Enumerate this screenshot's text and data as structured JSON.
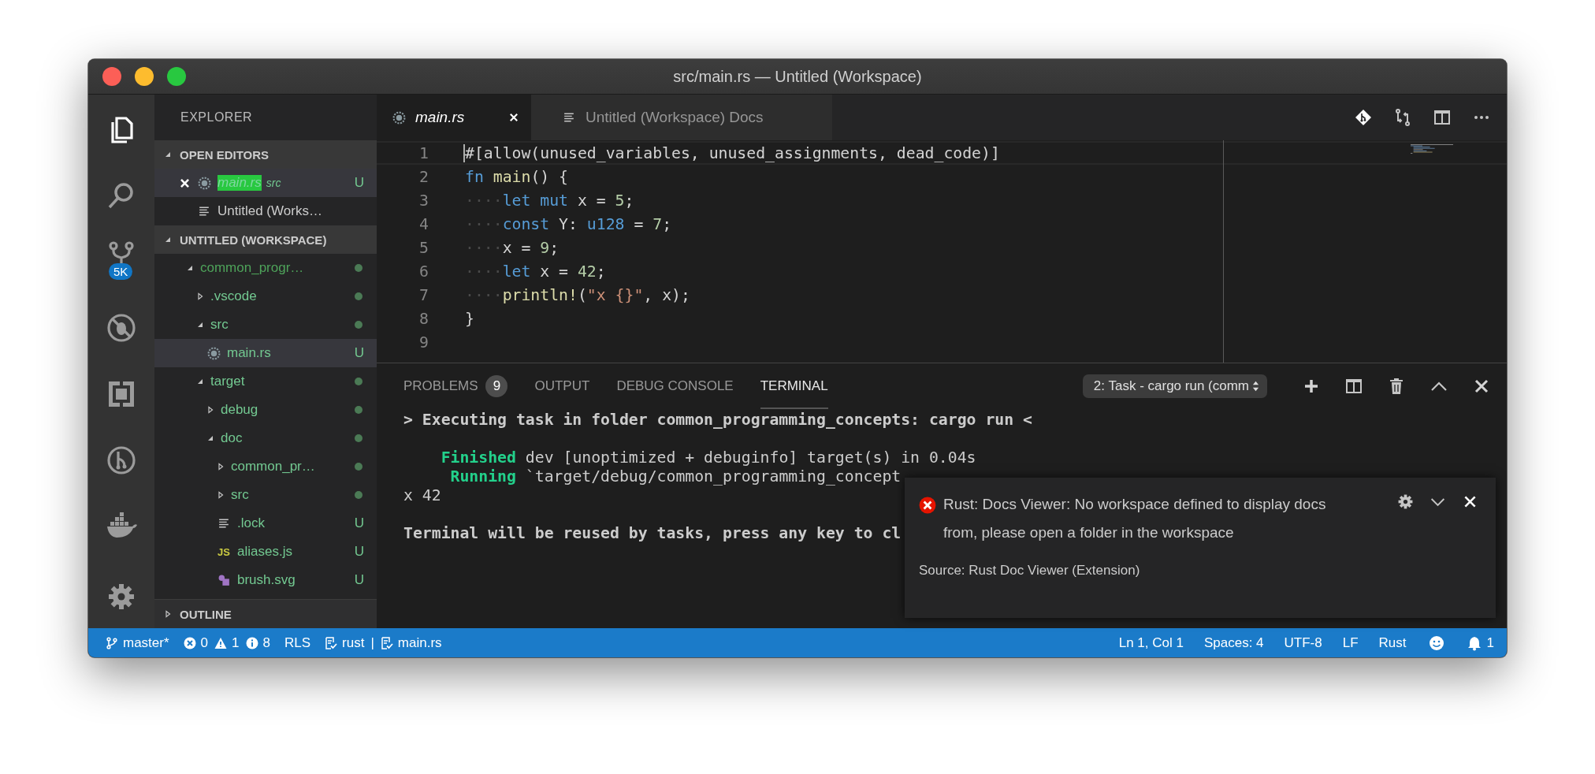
{
  "window": {
    "title": "src/main.rs — Untitled (Workspace)"
  },
  "activity_bar": [
    {
      "kind": "files",
      "selected": true
    },
    {
      "kind": "search",
      "selected": false
    },
    {
      "kind": "source-control",
      "selected": false,
      "badge": "5K"
    },
    {
      "kind": "no-debug",
      "selected": false
    },
    {
      "kind": "extensions",
      "selected": false
    },
    {
      "kind": "git-graph",
      "selected": false
    },
    {
      "kind": "docker",
      "selected": false
    }
  ],
  "sidebar": {
    "title": "EXPLORER",
    "open_editors": {
      "title": "OPEN EDITORS",
      "expanded": true,
      "items": [
        {
          "name": "main.rs",
          "detail": "src",
          "kind": "rust",
          "badge": "U",
          "selected": true,
          "preview": true,
          "close": true
        },
        {
          "name": "Untitled (Works…",
          "kind": "lines",
          "selected": false,
          "preview": false,
          "close": false
        }
      ]
    },
    "workspace": {
      "title": "UNTITLED (WORKSPACE)",
      "expanded": true,
      "items": [
        {
          "name": "common_progr…",
          "kind": "folder",
          "expanded": true,
          "dot": true,
          "color": "#4ea35a",
          "selected": false,
          "children": [
            {
              "name": ".vscode",
              "kind": "folder",
              "expanded": false,
              "dot": true,
              "color": "#73c991",
              "selected": false
            },
            {
              "name": "src",
              "kind": "folder",
              "expanded": true,
              "dot": true,
              "color": "#73c991",
              "selected": false,
              "children": [
                {
                  "name": "main.rs",
                  "kind": "rust",
                  "badge": "U",
                  "color": "#73c991",
                  "selected": true
                }
              ]
            },
            {
              "name": "target",
              "kind": "folder",
              "expanded": true,
              "dot": true,
              "color": "#73c991",
              "selected": false,
              "children": [
                {
                  "name": "debug",
                  "kind": "folder",
                  "expanded": false,
                  "dot": true,
                  "color": "#73c991",
                  "selected": false
                },
                {
                  "name": "doc",
                  "kind": "folder",
                  "expanded": true,
                  "dot": true,
                  "color": "#73c991",
                  "selected": false,
                  "children": [
                    {
                      "name": "common_pr…",
                      "kind": "folder",
                      "expanded": false,
                      "dot": true,
                      "color": "#73c991",
                      "selected": false
                    },
                    {
                      "name": "src",
                      "kind": "folder",
                      "expanded": false,
                      "dot": true,
                      "color": "#73c991",
                      "selected": false
                    },
                    {
                      "name": ".lock",
                      "kind": "lines",
                      "badge": "U",
                      "color": "#73c991",
                      "selected": false
                    },
                    {
                      "name": "aliases.js",
                      "kind": "js",
                      "icon_label": "JS",
                      "badge": "U",
                      "color": "#73c991",
                      "selected": false
                    },
                    {
                      "name": "brush.svg",
                      "kind": "svg",
                      "badge": "U",
                      "color": "#73c991",
                      "selected": false
                    }
                  ]
                }
              ]
            }
          ]
        }
      ]
    },
    "outline": {
      "title": "OUTLINE",
      "expanded": false
    }
  },
  "editor": {
    "tabs": [
      {
        "name": "main.rs",
        "kind": "rust",
        "selected": true,
        "preview": true,
        "close": true
      },
      {
        "name": "Untitled (Workspace) Docs",
        "kind": "lines",
        "selected": false,
        "preview": false,
        "close": false
      }
    ],
    "actions": [
      {
        "kind": "git"
      },
      {
        "kind": "compare"
      },
      {
        "kind": "split"
      },
      {
        "kind": "more"
      }
    ],
    "lines": [
      {
        "number": "1",
        "current": true,
        "tokens": [
          {
            "kind": "plain",
            "text": "#[allow(unused_variables, unused_assignments, dead_code)]"
          }
        ]
      },
      {
        "number": "2",
        "current": false,
        "tokens": [
          {
            "kind": "kw",
            "text": "fn "
          },
          {
            "kind": "fn",
            "text": "main"
          },
          {
            "kind": "plain",
            "text": "() {"
          }
        ]
      },
      {
        "number": "3",
        "current": false,
        "tokens": [
          {
            "kind": "ws",
            "text": "····"
          },
          {
            "kind": "kw",
            "text": "let mut"
          },
          {
            "kind": "plain",
            "text": " x = "
          },
          {
            "kind": "num",
            "text": "5"
          },
          {
            "kind": "plain",
            "text": ";"
          }
        ]
      },
      {
        "number": "4",
        "current": false,
        "tokens": [
          {
            "kind": "ws",
            "text": "····"
          },
          {
            "kind": "kw",
            "text": "const"
          },
          {
            "kind": "plain",
            "text": " Y: "
          },
          {
            "kind": "kw",
            "text": "u128"
          },
          {
            "kind": "plain",
            "text": " = "
          },
          {
            "kind": "num",
            "text": "7"
          },
          {
            "kind": "plain",
            "text": ";"
          }
        ]
      },
      {
        "number": "5",
        "current": false,
        "tokens": [
          {
            "kind": "ws",
            "text": "····"
          },
          {
            "kind": "plain",
            "text": "x = "
          },
          {
            "kind": "num",
            "text": "9"
          },
          {
            "kind": "plain",
            "text": ";"
          }
        ]
      },
      {
        "number": "6",
        "current": false,
        "tokens": [
          {
            "kind": "ws",
            "text": "····"
          },
          {
            "kind": "kw",
            "text": "let"
          },
          {
            "kind": "plain",
            "text": " x = "
          },
          {
            "kind": "num",
            "text": "42"
          },
          {
            "kind": "plain",
            "text": ";"
          }
        ]
      },
      {
        "number": "7",
        "current": false,
        "tokens": [
          {
            "kind": "ws",
            "text": "····"
          },
          {
            "kind": "fn",
            "text": "println!"
          },
          {
            "kind": "plain",
            "text": "("
          },
          {
            "kind": "str",
            "text": "\"x {}\""
          },
          {
            "kind": "plain",
            "text": ", x);"
          }
        ]
      },
      {
        "number": "8",
        "current": false,
        "tokens": [
          {
            "kind": "plain",
            "text": "}"
          }
        ]
      },
      {
        "number": "9",
        "current": false
      }
    ]
  },
  "panel": {
    "tabs": [
      {
        "label": "PROBLEMS",
        "badge": "9",
        "selected": false
      },
      {
        "label": "OUTPUT",
        "selected": false
      },
      {
        "label": "DEBUG CONSOLE",
        "selected": false
      },
      {
        "label": "TERMINAL",
        "selected": true
      }
    ],
    "terminal_select": {
      "value": "2: Task - cargo run (comm"
    },
    "actions": [
      {
        "kind": "add"
      },
      {
        "kind": "split"
      },
      {
        "kind": "trash"
      },
      {
        "kind": "maximize"
      },
      {
        "kind": "close"
      }
    ],
    "terminal": [
      {
        "kind": "text",
        "tokens": [
          {
            "kind": "bold",
            "text": "> Executing task in folder common_programming_concepts: cargo run <"
          }
        ]
      },
      {
        "kind": "blank"
      },
      {
        "kind": "text",
        "tokens": [
          {
            "kind": "success",
            "text": "    Finished"
          },
          {
            "kind": "plain",
            "text": " dev [unoptimized + debuginfo] target(s) in 0.04s"
          }
        ]
      },
      {
        "kind": "text",
        "tokens": [
          {
            "kind": "success",
            "text": "     Running"
          },
          {
            "kind": "plain",
            "text": " `target/debug/common_programming_concept"
          }
        ]
      },
      {
        "kind": "text",
        "tokens": [
          {
            "kind": "plain",
            "text": "x 42"
          }
        ]
      },
      {
        "kind": "blank"
      },
      {
        "kind": "text",
        "tokens": [
          {
            "kind": "bold",
            "text": "Terminal will be reused by tasks, press any key to cl"
          }
        ]
      }
    ]
  },
  "notification": {
    "message": "Rust: Docs Viewer: No workspace defined to display docs from, please open a folder in the workspace",
    "source": "Source: Rust Doc Viewer (Extension)"
  },
  "status_bar": {
    "left": [
      {
        "kind": "branch",
        "text": "master*"
      },
      {
        "kind": "errors",
        "text": "0"
      },
      {
        "kind": "warnings",
        "text": "1"
      },
      {
        "kind": "infos",
        "text": "8"
      },
      {
        "kind": "plain",
        "text": "RLS"
      },
      {
        "kind": "task",
        "text": "rust"
      },
      {
        "kind": "separator",
        "text": "|"
      },
      {
        "kind": "task",
        "text": "main.rs"
      }
    ],
    "right": [
      {
        "kind": "plain",
        "text": "Ln 1, Col 1"
      },
      {
        "kind": "plain",
        "text": "Spaces: 4"
      },
      {
        "kind": "plain",
        "text": "UTF-8"
      },
      {
        "kind": "plain",
        "text": "LF"
      },
      {
        "kind": "plain",
        "text": "Rust"
      },
      {
        "kind": "feedback"
      },
      {
        "kind": "bell",
        "text": "1"
      }
    ]
  }
}
